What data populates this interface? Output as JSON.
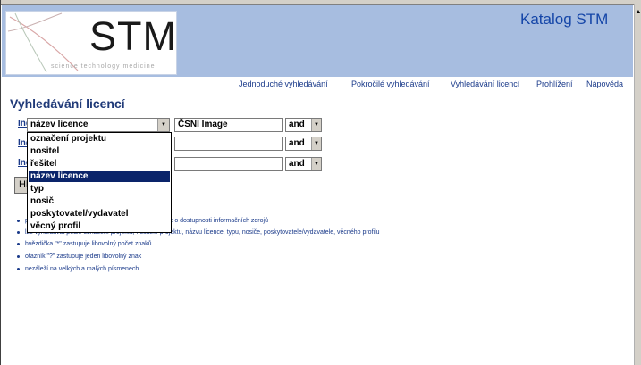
{
  "header": {
    "logo_text": "STM",
    "logo_subtitle": "science technology medicine",
    "site_title": "Katalog STM"
  },
  "nav": [
    {
      "label": "Jednoduché vyhledávání"
    },
    {
      "label": "Pokročilé vyhledávání"
    },
    {
      "label": "Vyhledávání licencí"
    },
    {
      "label": "Prohlížení"
    },
    {
      "label": "Nápověda"
    }
  ],
  "page_title": "Vyhledávání licencí",
  "form": {
    "rows": [
      {
        "index_label": "Index",
        "field_value": "název licence",
        "text_value": "ČSNI Image",
        "operator": "and"
      },
      {
        "index_label": "Index",
        "field_value": "",
        "text_value": "",
        "operator": "and"
      },
      {
        "index_label": "Index",
        "field_value": "",
        "text_value": "",
        "operator": "and"
      }
    ],
    "search_button_label": "Hledat"
  },
  "dropdown": {
    "options": [
      "označení projektu",
      "nositel",
      "řešitel",
      "název licence",
      "typ",
      "nosič",
      "poskytovatel/vydavatel",
      "věcný profil"
    ],
    "selected_index": 3
  },
  "help_bullets": [
    "poskytuje informace o licencovaných zdrojích a údaje o dostupnosti informačních zdrojů",
    "lze vyhledávat podle označení projektu, nositele projektu, názvu licence, typu, nosiče, poskytovatele/vydavatele, věcného profilu",
    "hvězdička \"*\" zastupuje libovolný počet znaků",
    "otazník \"?\" zastupuje jeden libovolný znak",
    "nezáleží na velkých a malých písmenech"
  ],
  "colors": {
    "header_band": "#a7bde0",
    "link": "#1a3a8a",
    "title": "#203a78",
    "selection": "#0a246a"
  }
}
